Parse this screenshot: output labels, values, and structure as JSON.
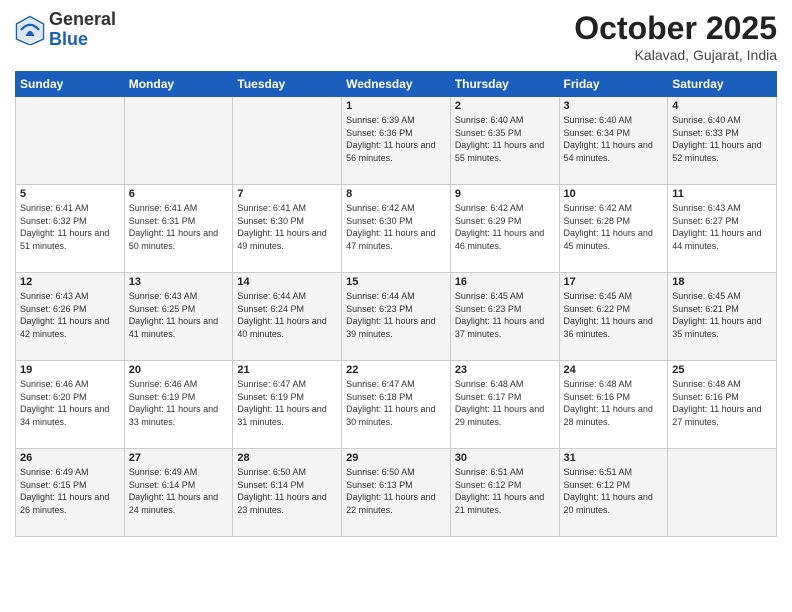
{
  "header": {
    "logo": {
      "general": "General",
      "blue": "Blue"
    },
    "title": "October 2025",
    "location": "Kalavad, Gujarat, India"
  },
  "calendar": {
    "days_of_week": [
      "Sunday",
      "Monday",
      "Tuesday",
      "Wednesday",
      "Thursday",
      "Friday",
      "Saturday"
    ],
    "weeks": [
      [
        {
          "day": "",
          "sunrise": "",
          "sunset": "",
          "daylight": ""
        },
        {
          "day": "",
          "sunrise": "",
          "sunset": "",
          "daylight": ""
        },
        {
          "day": "",
          "sunrise": "",
          "sunset": "",
          "daylight": ""
        },
        {
          "day": "1",
          "sunrise": "Sunrise: 6:39 AM",
          "sunset": "Sunset: 6:36 PM",
          "daylight": "Daylight: 11 hours and 56 minutes."
        },
        {
          "day": "2",
          "sunrise": "Sunrise: 6:40 AM",
          "sunset": "Sunset: 6:35 PM",
          "daylight": "Daylight: 11 hours and 55 minutes."
        },
        {
          "day": "3",
          "sunrise": "Sunrise: 6:40 AM",
          "sunset": "Sunset: 6:34 PM",
          "daylight": "Daylight: 11 hours and 54 minutes."
        },
        {
          "day": "4",
          "sunrise": "Sunrise: 6:40 AM",
          "sunset": "Sunset: 6:33 PM",
          "daylight": "Daylight: 11 hours and 52 minutes."
        }
      ],
      [
        {
          "day": "5",
          "sunrise": "Sunrise: 6:41 AM",
          "sunset": "Sunset: 6:32 PM",
          "daylight": "Daylight: 11 hours and 51 minutes."
        },
        {
          "day": "6",
          "sunrise": "Sunrise: 6:41 AM",
          "sunset": "Sunset: 6:31 PM",
          "daylight": "Daylight: 11 hours and 50 minutes."
        },
        {
          "day": "7",
          "sunrise": "Sunrise: 6:41 AM",
          "sunset": "Sunset: 6:30 PM",
          "daylight": "Daylight: 11 hours and 49 minutes."
        },
        {
          "day": "8",
          "sunrise": "Sunrise: 6:42 AM",
          "sunset": "Sunset: 6:30 PM",
          "daylight": "Daylight: 11 hours and 47 minutes."
        },
        {
          "day": "9",
          "sunrise": "Sunrise: 6:42 AM",
          "sunset": "Sunset: 6:29 PM",
          "daylight": "Daylight: 11 hours and 46 minutes."
        },
        {
          "day": "10",
          "sunrise": "Sunrise: 6:42 AM",
          "sunset": "Sunset: 6:28 PM",
          "daylight": "Daylight: 11 hours and 45 minutes."
        },
        {
          "day": "11",
          "sunrise": "Sunrise: 6:43 AM",
          "sunset": "Sunset: 6:27 PM",
          "daylight": "Daylight: 11 hours and 44 minutes."
        }
      ],
      [
        {
          "day": "12",
          "sunrise": "Sunrise: 6:43 AM",
          "sunset": "Sunset: 6:26 PM",
          "daylight": "Daylight: 11 hours and 42 minutes."
        },
        {
          "day": "13",
          "sunrise": "Sunrise: 6:43 AM",
          "sunset": "Sunset: 6:25 PM",
          "daylight": "Daylight: 11 hours and 41 minutes."
        },
        {
          "day": "14",
          "sunrise": "Sunrise: 6:44 AM",
          "sunset": "Sunset: 6:24 PM",
          "daylight": "Daylight: 11 hours and 40 minutes."
        },
        {
          "day": "15",
          "sunrise": "Sunrise: 6:44 AM",
          "sunset": "Sunset: 6:23 PM",
          "daylight": "Daylight: 11 hours and 39 minutes."
        },
        {
          "day": "16",
          "sunrise": "Sunrise: 6:45 AM",
          "sunset": "Sunset: 6:23 PM",
          "daylight": "Daylight: 11 hours and 37 minutes."
        },
        {
          "day": "17",
          "sunrise": "Sunrise: 6:45 AM",
          "sunset": "Sunset: 6:22 PM",
          "daylight": "Daylight: 11 hours and 36 minutes."
        },
        {
          "day": "18",
          "sunrise": "Sunrise: 6:45 AM",
          "sunset": "Sunset: 6:21 PM",
          "daylight": "Daylight: 11 hours and 35 minutes."
        }
      ],
      [
        {
          "day": "19",
          "sunrise": "Sunrise: 6:46 AM",
          "sunset": "Sunset: 6:20 PM",
          "daylight": "Daylight: 11 hours and 34 minutes."
        },
        {
          "day": "20",
          "sunrise": "Sunrise: 6:46 AM",
          "sunset": "Sunset: 6:19 PM",
          "daylight": "Daylight: 11 hours and 33 minutes."
        },
        {
          "day": "21",
          "sunrise": "Sunrise: 6:47 AM",
          "sunset": "Sunset: 6:19 PM",
          "daylight": "Daylight: 11 hours and 31 minutes."
        },
        {
          "day": "22",
          "sunrise": "Sunrise: 6:47 AM",
          "sunset": "Sunset: 6:18 PM",
          "daylight": "Daylight: 11 hours and 30 minutes."
        },
        {
          "day": "23",
          "sunrise": "Sunrise: 6:48 AM",
          "sunset": "Sunset: 6:17 PM",
          "daylight": "Daylight: 11 hours and 29 minutes."
        },
        {
          "day": "24",
          "sunrise": "Sunrise: 6:48 AM",
          "sunset": "Sunset: 6:16 PM",
          "daylight": "Daylight: 11 hours and 28 minutes."
        },
        {
          "day": "25",
          "sunrise": "Sunrise: 6:48 AM",
          "sunset": "Sunset: 6:16 PM",
          "daylight": "Daylight: 11 hours and 27 minutes."
        }
      ],
      [
        {
          "day": "26",
          "sunrise": "Sunrise: 6:49 AM",
          "sunset": "Sunset: 6:15 PM",
          "daylight": "Daylight: 11 hours and 26 minutes."
        },
        {
          "day": "27",
          "sunrise": "Sunrise: 6:49 AM",
          "sunset": "Sunset: 6:14 PM",
          "daylight": "Daylight: 11 hours and 24 minutes."
        },
        {
          "day": "28",
          "sunrise": "Sunrise: 6:50 AM",
          "sunset": "Sunset: 6:14 PM",
          "daylight": "Daylight: 11 hours and 23 minutes."
        },
        {
          "day": "29",
          "sunrise": "Sunrise: 6:50 AM",
          "sunset": "Sunset: 6:13 PM",
          "daylight": "Daylight: 11 hours and 22 minutes."
        },
        {
          "day": "30",
          "sunrise": "Sunrise: 6:51 AM",
          "sunset": "Sunset: 6:12 PM",
          "daylight": "Daylight: 11 hours and 21 minutes."
        },
        {
          "day": "31",
          "sunrise": "Sunrise: 6:51 AM",
          "sunset": "Sunset: 6:12 PM",
          "daylight": "Daylight: 11 hours and 20 minutes."
        },
        {
          "day": "",
          "sunrise": "",
          "sunset": "",
          "daylight": ""
        }
      ]
    ]
  }
}
